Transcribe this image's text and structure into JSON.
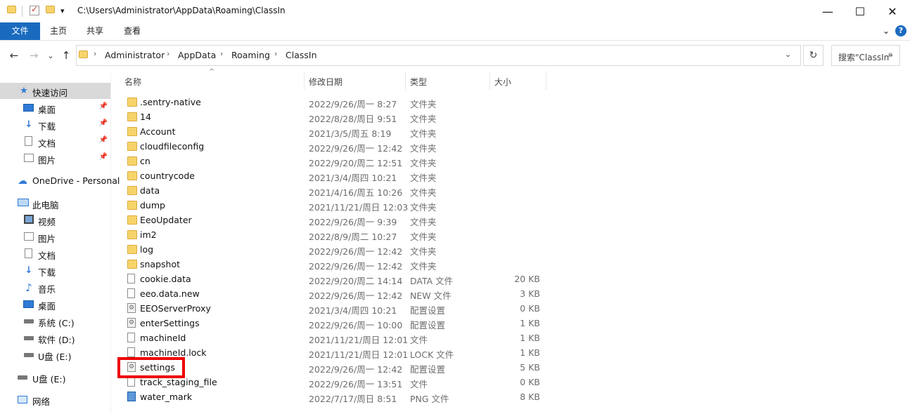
{
  "window": {
    "title_path": "C:\\Users\\Administrator\\AppData\\Roaming\\ClassIn",
    "minimize": "—",
    "maximize": "☐",
    "close": "✕",
    "quick_access_dropdown": "▾"
  },
  "ribbon": {
    "tabs": [
      "文件",
      "主页",
      "共享",
      "查看"
    ],
    "expand": "⌄",
    "help": "?"
  },
  "address": {
    "back": "←",
    "forward": "→",
    "recent": "⌄",
    "up": "↑",
    "crumbs": [
      "Administrator",
      "AppData",
      "Roaming",
      "ClassIn"
    ],
    "separator": "›",
    "dropdown": "⌄",
    "refresh": "↻",
    "search_placeholder": "搜索\"ClassIn\""
  },
  "nav": {
    "quick_access": "快速访问",
    "quick_items": [
      "桌面",
      "下载",
      "文档",
      "图片"
    ],
    "onedrive": "OneDrive - Personal",
    "this_pc": "此电脑",
    "pc_items": [
      "视频",
      "图片",
      "文档",
      "下载",
      "音乐",
      "桌面",
      "系统 (C:)",
      "软件 (D:)",
      "U盘 (E:)"
    ],
    "usb": "U盘 (E:)",
    "network": "网络"
  },
  "columns": {
    "sort_indicator": "^",
    "name": "名称",
    "date": "修改日期",
    "type": "类型",
    "size": "大小"
  },
  "files": [
    {
      "name": ".sentry-native",
      "date": "2022/9/26/周一 8:27",
      "type": "文件夹",
      "size": "",
      "icon": "folder"
    },
    {
      "name": "14",
      "date": "2022/8/28/周日 9:51",
      "type": "文件夹",
      "size": "",
      "icon": "folder"
    },
    {
      "name": "Account",
      "date": "2021/3/5/周五 8:19",
      "type": "文件夹",
      "size": "",
      "icon": "folder"
    },
    {
      "name": "cloudfileconfig",
      "date": "2022/9/26/周一 12:42",
      "type": "文件夹",
      "size": "",
      "icon": "folder"
    },
    {
      "name": "cn",
      "date": "2022/9/20/周二 12:51",
      "type": "文件夹",
      "size": "",
      "icon": "folder"
    },
    {
      "name": "countrycode",
      "date": "2021/3/4/周四 10:21",
      "type": "文件夹",
      "size": "",
      "icon": "folder"
    },
    {
      "name": "data",
      "date": "2021/4/16/周五 10:26",
      "type": "文件夹",
      "size": "",
      "icon": "folder"
    },
    {
      "name": "dump",
      "date": "2021/11/21/周日 12:03",
      "type": "文件夹",
      "size": "",
      "icon": "folder"
    },
    {
      "name": "EeoUpdater",
      "date": "2022/9/26/周一 9:39",
      "type": "文件夹",
      "size": "",
      "icon": "folder"
    },
    {
      "name": "im2",
      "date": "2022/8/9/周二 10:27",
      "type": "文件夹",
      "size": "",
      "icon": "folder"
    },
    {
      "name": "log",
      "date": "2022/9/26/周一 12:42",
      "type": "文件夹",
      "size": "",
      "icon": "folder"
    },
    {
      "name": "snapshot",
      "date": "2022/9/26/周一 12:42",
      "type": "文件夹",
      "size": "",
      "icon": "folder"
    },
    {
      "name": "cookie.data",
      "date": "2022/9/20/周二 14:14",
      "type": "DATA 文件",
      "size": "20 KB",
      "icon": "file"
    },
    {
      "name": "eeo.data.new",
      "date": "2022/9/26/周一 12:42",
      "type": "NEW 文件",
      "size": "3 KB",
      "icon": "file"
    },
    {
      "name": "EEOServerProxy",
      "date": "2021/3/4/周四 10:21",
      "type": "配置设置",
      "size": "0 KB",
      "icon": "config"
    },
    {
      "name": "enterSettings",
      "date": "2022/9/26/周一 10:00",
      "type": "配置设置",
      "size": "1 KB",
      "icon": "config"
    },
    {
      "name": "machineId",
      "date": "2021/11/21/周日 12:01",
      "type": "文件",
      "size": "1 KB",
      "icon": "file"
    },
    {
      "name": "machineId.lock",
      "date": "2021/11/21/周日 12:01",
      "type": "LOCK 文件",
      "size": "1 KB",
      "icon": "file"
    },
    {
      "name": "settings",
      "date": "2022/9/26/周一 12:42",
      "type": "配置设置",
      "size": "5 KB",
      "icon": "config"
    },
    {
      "name": "track_staging_file",
      "date": "2022/9/26/周一 13:51",
      "type": "文件",
      "size": "0 KB",
      "icon": "file"
    },
    {
      "name": "water_mark",
      "date": "2022/7/17/周日 8:51",
      "type": "PNG 文件",
      "size": "8 KB",
      "icon": "png"
    }
  ],
  "colors": {
    "file_tab": "#1a6bbf",
    "highlight": "#ee0000",
    "folder": "#f7d46b"
  }
}
